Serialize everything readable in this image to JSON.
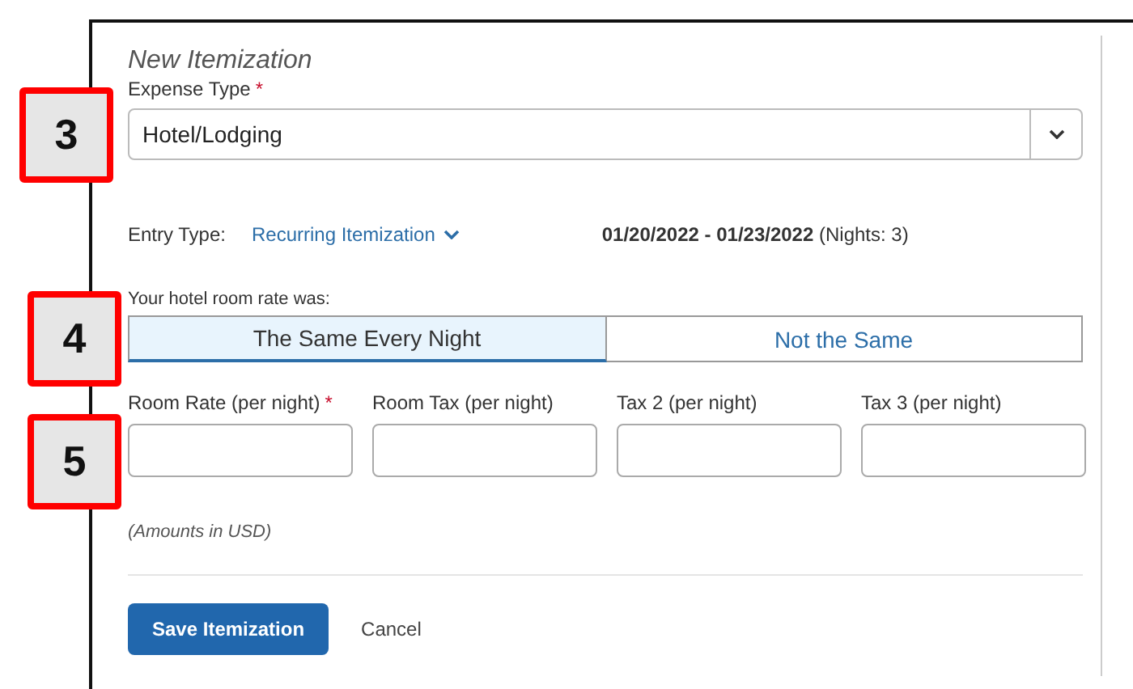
{
  "title": "New Itemization",
  "expense_type": {
    "label": "Expense Type",
    "required_mark": "*",
    "value": "Hotel/Lodging"
  },
  "entry_type": {
    "label": "Entry Type:",
    "value": "Recurring Itemization"
  },
  "date_range": {
    "dates": "01/20/2022 - 01/23/2022",
    "nights": "(Nights: 3)"
  },
  "rate_question": "Your hotel room rate was:",
  "rate_options": [
    {
      "label": "The Same Every Night",
      "selected": true
    },
    {
      "label": "Not the Same",
      "selected": false
    }
  ],
  "amount_fields": [
    {
      "label": "Room Rate (per night)",
      "required_mark": "*"
    },
    {
      "label": "Room Tax (per night)"
    },
    {
      "label": "Tax 2 (per night)"
    },
    {
      "label": "Tax 3 (per night)"
    }
  ],
  "currency_note": "(Amounts in USD)",
  "buttons": [
    {
      "label": "Save Itemization",
      "kind": "primary"
    },
    {
      "label": "Cancel",
      "kind": "link"
    }
  ],
  "callouts": [
    {
      "label": "3"
    },
    {
      "label": "4"
    },
    {
      "label": "5"
    }
  ]
}
